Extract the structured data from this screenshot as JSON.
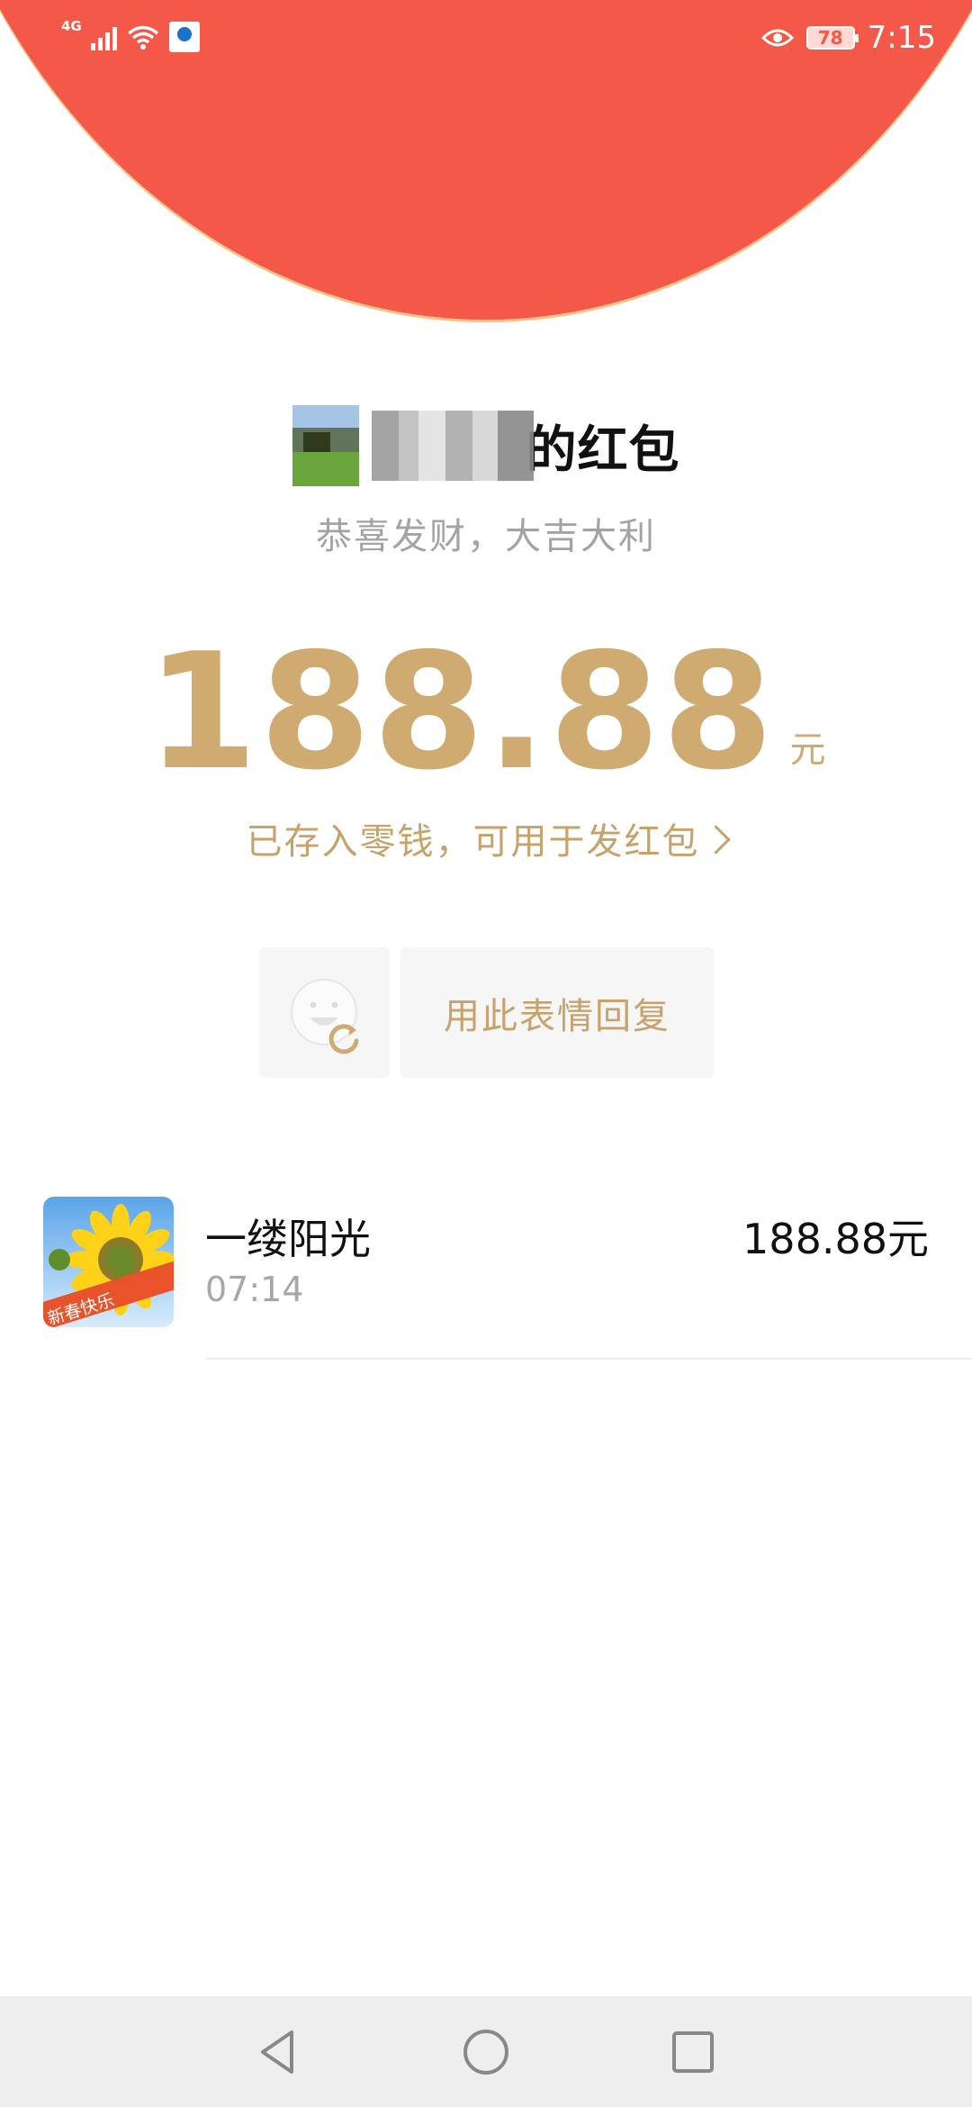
{
  "status_bar": {
    "network": "4G",
    "battery": "78",
    "time": "7:15"
  },
  "icons": {
    "back": "back-arrow-icon",
    "more": "more-options-icon",
    "emoji": "smiley-refresh-icon",
    "nav_back": "triangle-back-icon",
    "nav_home": "circle-home-icon",
    "nav_recents": "square-recents-icon"
  },
  "header": {
    "title_suffix": "的红包",
    "blessing": "恭喜发财，大吉大利"
  },
  "amount": {
    "value": "188.88",
    "unit": "元",
    "saved_notice": "已存入零钱，可用于发红包"
  },
  "actions": {
    "reply_with_sticker": "用此表情回复"
  },
  "records": [
    {
      "name": "一缕阳光",
      "time": "07:14",
      "amount": "188.88元",
      "avatar_caption": "新春快乐"
    }
  ],
  "colors": {
    "header_red": "#f45849",
    "header_edge": "#f0c48b",
    "gold_text": "#cfab72"
  }
}
